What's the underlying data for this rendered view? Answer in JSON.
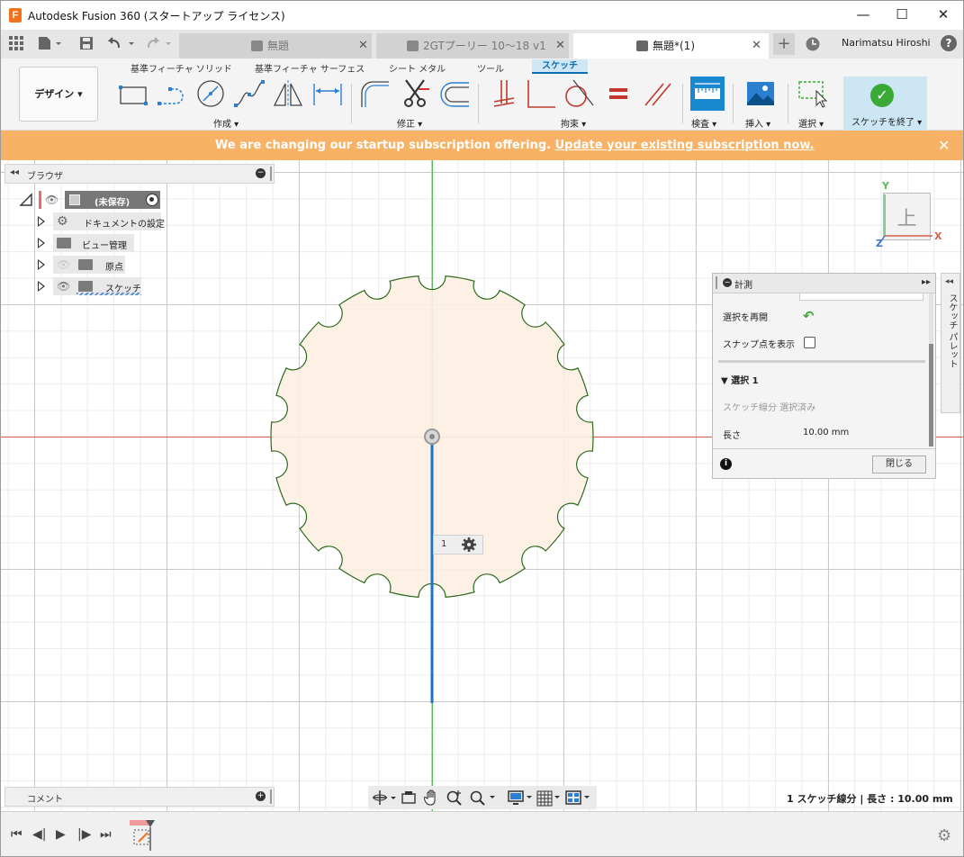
{
  "window": {
    "title": "Autodesk Fusion 360 (スタートアップ ライセンス)",
    "logo": "F",
    "min": "—",
    "max": "☐",
    "close": "✕"
  },
  "tabs": [
    {
      "label": "無題",
      "active": false
    },
    {
      "label": "2GTプーリー 10～18 v1",
      "active": false
    },
    {
      "label": "無題*(1)",
      "active": true
    }
  ],
  "tabbar": {
    "add": "+",
    "user": "Narimatsu Hiroshi",
    "help": "?"
  },
  "workspace": {
    "label": "デザイン ▾"
  },
  "ribbon": {
    "tabs": [
      "基準フィーチャ ソリッド",
      "基準フィーチャ サーフェス",
      "シート メタル",
      "ツール",
      "スケッチ"
    ],
    "groups": [
      "作成 ▾",
      "修正 ▾",
      "拘束 ▾",
      "検査 ▾",
      "挿入 ▾",
      "選択 ▾"
    ],
    "finish": "スケッチを終了 ▾"
  },
  "banner": {
    "text": "We are changing our startup subscription offering. ",
    "link": "Update your existing subscription now.",
    "close": "✕"
  },
  "browser": {
    "title": "ブラウザ",
    "root": "(未保存)",
    "items": [
      "ドキュメントの設定",
      "ビュー管理",
      "原点",
      "スケッチ"
    ]
  },
  "measure": {
    "title": "計測",
    "restart_label": "選択を再開",
    "snap_label": "スナップ点を表示",
    "selection_heading": "選択  1",
    "selection_desc": "スケッチ線分  選択済み",
    "length_label": "長さ",
    "length_value": "10.00 mm",
    "close_button": "閉じる",
    "info": "i"
  },
  "palette": {
    "label": "スケッチ パレット"
  },
  "viewcube": {
    "face": "上",
    "x": "X",
    "y": "Y",
    "z": "Z"
  },
  "canvas": {
    "dimension_label": "1"
  },
  "comment": {
    "label": "コメント"
  },
  "status": {
    "text": "1 スケッチ線分 | 長さ : 10.00 mm"
  },
  "colors": {
    "accent": "#0a6fb5",
    "banner": "#f8b266",
    "gear_fill": "#fdf0e2",
    "gear_stroke": "#2d6b1e",
    "selection": "#1a73c8"
  }
}
